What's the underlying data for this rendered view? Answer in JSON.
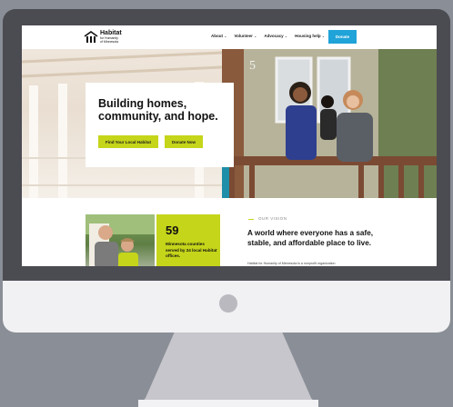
{
  "nav": {
    "logo_line1": "Habitat",
    "logo_line2": "for Humanity",
    "logo_line3": "of Minnesota",
    "menu": [
      "About",
      "Volunteer",
      "Advocacy",
      "Housing help"
    ],
    "donate_label": "Donate"
  },
  "hero": {
    "title": "Building homes, community, and hope.",
    "primary_button": "Find Your Local Habitat",
    "secondary_button": "Donate Now",
    "house_number": "5"
  },
  "stats": {
    "number": "59",
    "text": "Minnesota counties served by 24 local Habitat offices."
  },
  "vision": {
    "label": "OUR VISION",
    "heading": "A world where everyone has a safe, stable, and affordable place to live.",
    "body": "Habitat for Humanity of Minnesota is a nonprofit organization"
  },
  "colors": {
    "accent_green": "#c5d51a",
    "donate_blue": "#20a3d8",
    "monitor_frame": "#4b4b52",
    "background": "#8a8e96"
  }
}
